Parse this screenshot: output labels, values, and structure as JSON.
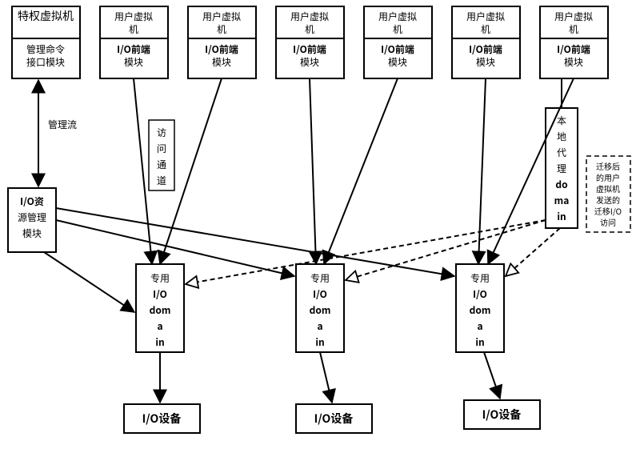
{
  "vm_priv": {
    "title": "特权虚拟机",
    "sub": "管理命令接口模块"
  },
  "vm_user": {
    "title": "用户虚拟机",
    "sub": "I/O前端模块"
  },
  "labels": {
    "mgmt_flow": "管理流",
    "access_channel_1": "访",
    "access_channel_2": "问",
    "access_channel_3": "通",
    "access_channel_4": "道",
    "io_res_mgr_1": "I/O资",
    "io_res_mgr_2": "源管理",
    "io_res_mgr_3": "模块",
    "local_proxy_1": "本",
    "local_proxy_2": "地",
    "local_proxy_3": "代",
    "local_proxy_4": "理",
    "local_proxy_5": "do",
    "local_proxy_6": "ma",
    "local_proxy_7": "in",
    "io_domain_1": "专用",
    "io_domain_2": "I/O",
    "io_domain_3": "dom",
    "io_domain_4": "a",
    "io_domain_5": "in",
    "io_device": "I/O设备",
    "dash_note_1": "迁移后",
    "dash_note_2": "的用户",
    "dash_note_3": "虚拟机",
    "dash_note_4": "发送的",
    "dash_note_5": "迁移I/O",
    "dash_note_6": "访问"
  }
}
